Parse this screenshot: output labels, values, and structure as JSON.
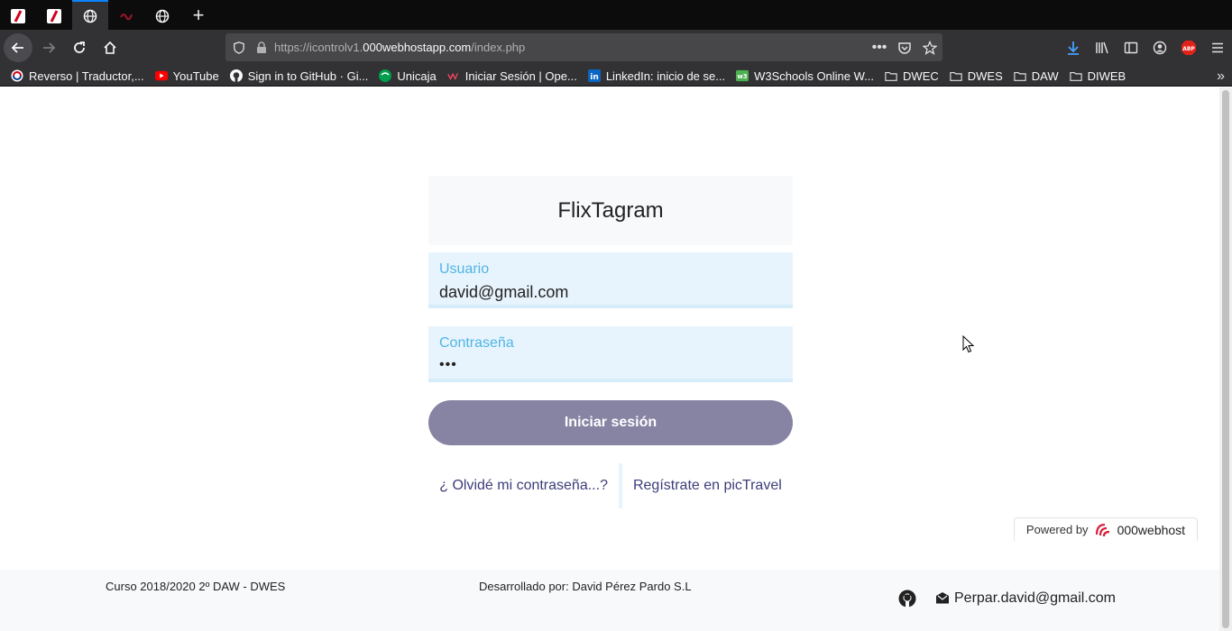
{
  "browser": {
    "url_prefix": "https://icontrolv1.",
    "url_domain": "000webhostapp.com",
    "url_path": "/index.php",
    "tabs": [
      {
        "icon": "red-slash-favicon-icon",
        "active": false
      },
      {
        "icon": "red-slash-favicon-icon",
        "active": false
      },
      {
        "icon": "globe-icon",
        "active": true
      },
      {
        "icon": "red-logo-favicon-icon",
        "active": false
      },
      {
        "icon": "globe-icon",
        "active": false
      }
    ],
    "new_tab": "+"
  },
  "bookmarks": [
    {
      "label": "Reverso | Traductor,...",
      "icon": "reverso-icon"
    },
    {
      "label": "YouTube",
      "icon": "youtube-icon"
    },
    {
      "label": "Sign in to GitHub · Gi...",
      "icon": "github-icon"
    },
    {
      "label": "Unicaja",
      "icon": "unicaja-icon"
    },
    {
      "label": "Iniciar Sesión | Ope...",
      "icon": "openwebinars-icon"
    },
    {
      "label": "LinkedIn: inicio de se...",
      "icon": "linkedin-icon"
    },
    {
      "label": "W3Schools Online W...",
      "icon": "w3schools-icon"
    },
    {
      "label": "DWEC",
      "icon": "folder-icon"
    },
    {
      "label": "DWES",
      "icon": "folder-icon"
    },
    {
      "label": "DAW",
      "icon": "folder-icon"
    },
    {
      "label": "DIWEB",
      "icon": "folder-icon"
    }
  ],
  "login": {
    "title": "FlixTagram",
    "user_label": "Usuario",
    "user_value": "david@gmail.com",
    "password_label": "Contraseña",
    "password_mask": "•••",
    "submit_label": "Iniciar sesión",
    "forgot_link": "¿ Olvidé mi contraseña...?",
    "register_link": "Regístrate en picTravel"
  },
  "footer": {
    "course": "Curso 2018/2020 2º DAW - DWES",
    "developer": "Desarrollado por: David Pérez Pardo S.L",
    "email": "Perpar.david@gmail.com"
  },
  "powered": {
    "label": "Powered by",
    "brand": "000webhost"
  },
  "colors": {
    "accent": "#0a84ff",
    "button": "#8783a3",
    "label": "#4fb6e3",
    "field_bg": "#e8f4fd",
    "link": "#3d3d7a"
  }
}
